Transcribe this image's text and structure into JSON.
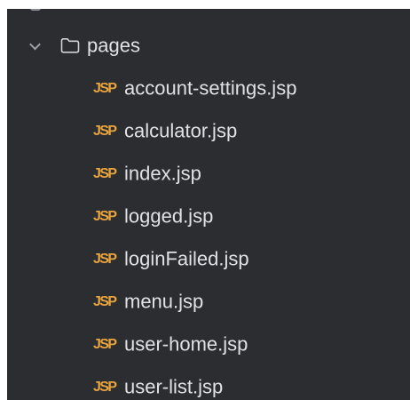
{
  "project_tree": {
    "folder": {
      "label": "pages",
      "icon": "folder-icon",
      "expanded": true
    },
    "files": [
      {
        "label": "account-settings.jsp",
        "icon": "jsp-file-icon",
        "icon_text": "JSP"
      },
      {
        "label": "calculator.jsp",
        "icon": "jsp-file-icon",
        "icon_text": "JSP"
      },
      {
        "label": "index.jsp",
        "icon": "jsp-file-icon",
        "icon_text": "JSP"
      },
      {
        "label": "logged.jsp",
        "icon": "jsp-file-icon",
        "icon_text": "JSP"
      },
      {
        "label": "loginFailed.jsp",
        "icon": "jsp-file-icon",
        "icon_text": "JSP"
      },
      {
        "label": "menu.jsp",
        "icon": "jsp-file-icon",
        "icon_text": "JSP"
      },
      {
        "label": "user-home.jsp",
        "icon": "jsp-file-icon",
        "icon_text": "JSP"
      },
      {
        "label": "user-list.jsp",
        "icon": "jsp-file-icon",
        "icon_text": "JSP"
      }
    ]
  },
  "colors": {
    "panel_background": "#2b2d30",
    "text": "#dfe1e5",
    "jsp_icon": "#e8a33d",
    "chevron": "#9da0a8"
  }
}
